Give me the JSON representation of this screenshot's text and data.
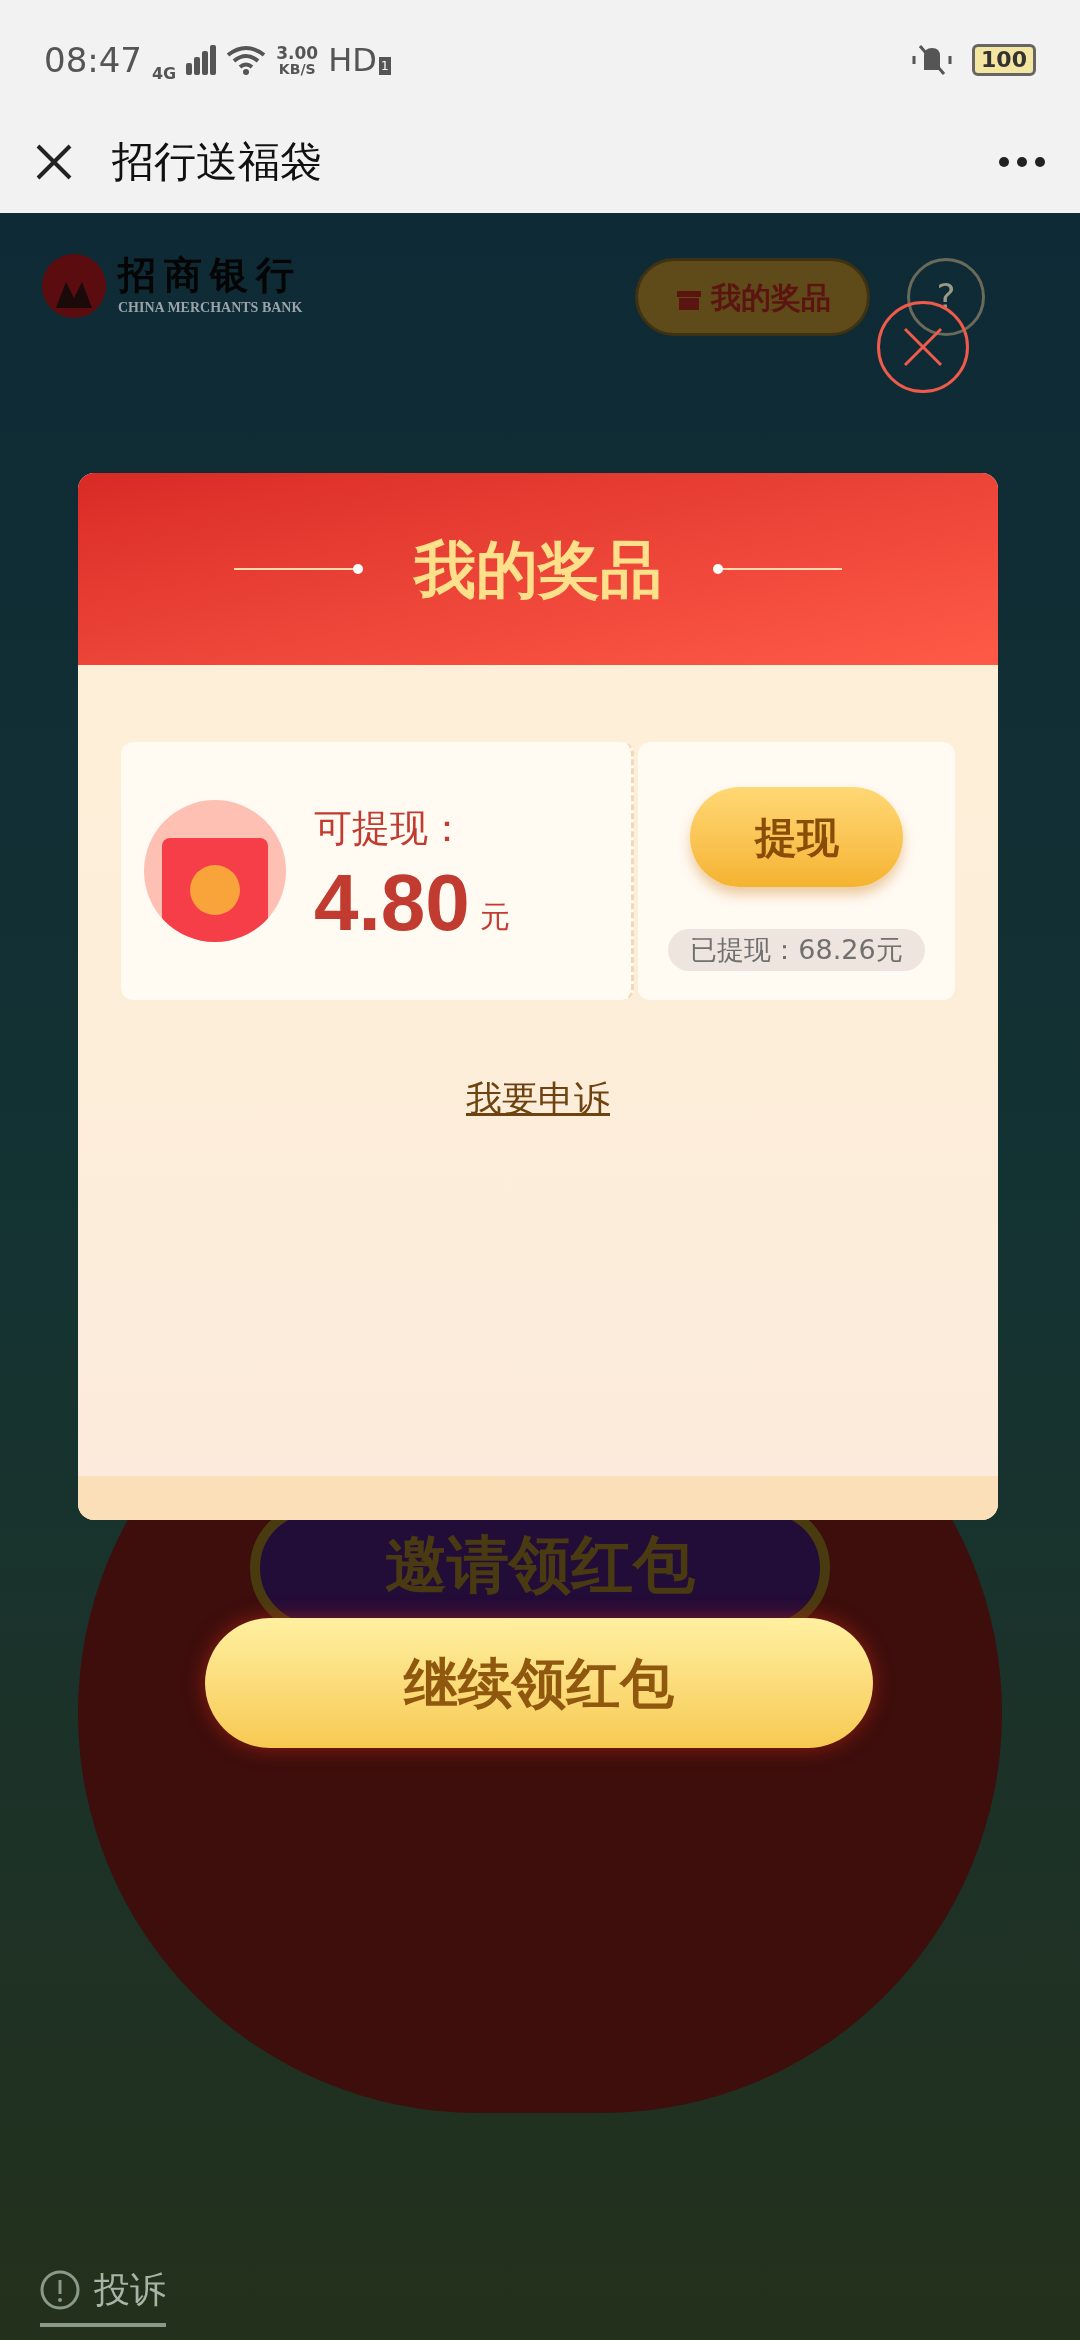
{
  "status_bar": {
    "time": "08:47",
    "network": "4G",
    "speed": "3.00",
    "speed_unit": "KB/S",
    "hd": "HD",
    "sim": "1",
    "battery": "100"
  },
  "nav": {
    "title": "招行送福袋"
  },
  "background": {
    "bank_name": "招商银行",
    "bank_name_en": "CHINA MERCHANTS BANK",
    "prizes_button": "我的奖品",
    "help": "?",
    "invite_button": "邀请领红包",
    "complaint": "投诉"
  },
  "dialog": {
    "title": "我的奖品",
    "withdrawable_label": "可提现：",
    "amount": "4.80",
    "unit": "元",
    "withdraw_button": "提现",
    "withdrawn": "已提现：68.26元",
    "appeal_link": "我要申诉"
  },
  "continue_button": "继续领红包"
}
